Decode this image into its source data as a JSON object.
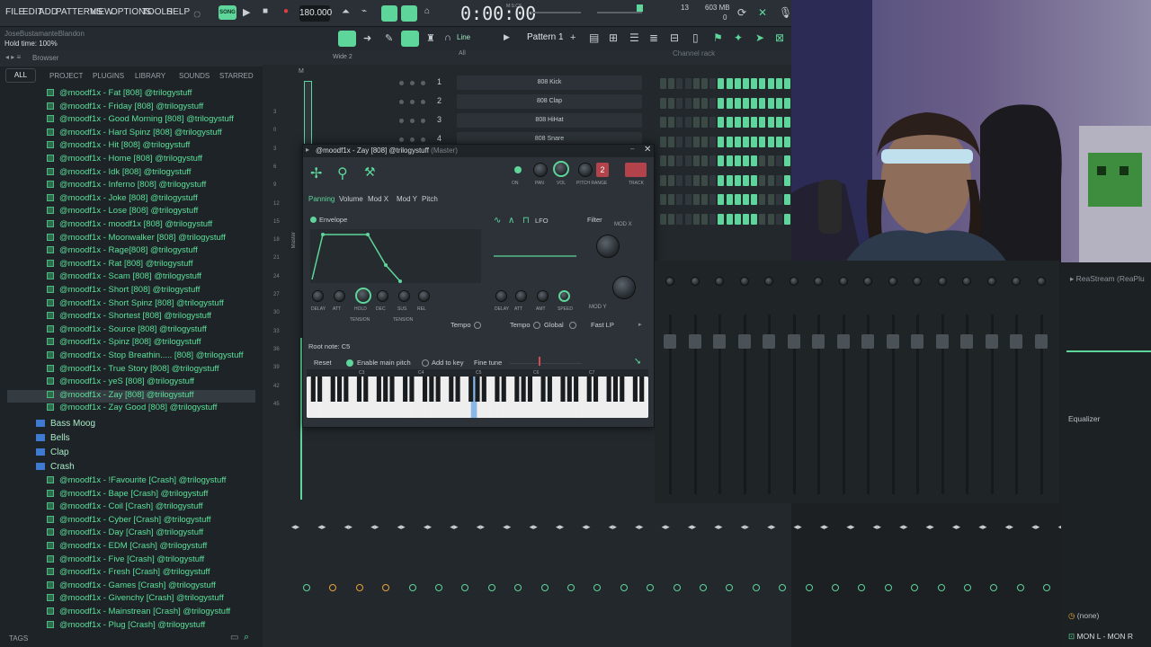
{
  "menu": {
    "file": "FILE",
    "edit": "EDIT",
    "add": "ADD",
    "patterns": "PATTERNS",
    "view": "VIEW",
    "options": "OPTIONS",
    "tools": "TOOLS",
    "help": "HELP"
  },
  "transport": {
    "song_label": "SONG",
    "tempo": "180.000",
    "time": "0:00:00",
    "time_label": "M:S:CS",
    "cpu_num": "13",
    "mem": "603 MB",
    "mem_sub": "0"
  },
  "hint": {
    "user": "JoseBustamanteBlandon",
    "hold_time": "Hold time: 100%"
  },
  "toolbar2": {
    "line": "Line",
    "pattern": "Pattern 1"
  },
  "browser": {
    "title": "Browser",
    "tabs": [
      "ALL",
      "PROJECT",
      "PLUGINS",
      "LIBRARY",
      "SOUNDS",
      "STARRED"
    ],
    "files_808": [
      "@moodf1x - Fat [808] @trilogystuff",
      "@moodf1x - Friday [808] @trilogystuff",
      "@moodf1x - Good Morning [808] @trilogystuff",
      "@moodf1x - Hard Spinz [808] @trilogystuff",
      "@moodf1x - Hit [808] @trilogystuff",
      "@moodf1x - Home [808] @trilogystuff",
      "@moodf1x - Idk [808] @trilogystuff",
      "@moodf1x - Inferno [808] @trilogystuff",
      "@moodf1x - Joke [808] @trilogystuff",
      "@moodf1x - Lose [808] @trilogystuff",
      "@moodf1x - moodf1x [808] @trilogystuff",
      "@moodf1x - Moonwalker [808] @trilogystuff",
      "@moodf1x - Rage[808] @trilogystuff",
      "@moodf1x - Rat [808] @trilogystuff",
      "@moodf1x - Scam [808] @trilogystuff",
      "@moodf1x - Short [808] @trilogystuff",
      "@moodf1x - Short Spinz [808] @trilogystuff",
      "@moodf1x - Shortest [808] @trilogystuff",
      "@moodf1x - Source [808] @trilogystuff",
      "@moodf1x - Spinz [808] @trilogystuff",
      "@moodf1x - Stop Breathin..... [808] @trilogystuff",
      "@moodf1x - True Story [808] @trilogystuff",
      "@moodf1x - yeS [808] @trilogystuff",
      "@moodf1x - Zay [808] @trilogystuff",
      "@moodf1x - Zay Good [808] @trilogystuff"
    ],
    "selected_index": 23,
    "folders": [
      "Bass Moog",
      "Bells",
      "Clap",
      "Crash"
    ],
    "files_crash": [
      "@moodf1x - !Favourite [Crash] @trilogystuff",
      "@moodf1x - Bape [Crash] @trilogystuff",
      "@moodf1x - Coil [Crash] @trilogystuff",
      "@moodf1x - Cyber [Crash] @trilogystuff",
      "@moodf1x - Day [Crash] @trilogystuff",
      "@moodf1x - EDM [Crash] @trilogystuff",
      "@moodf1x - Five [Crash] @trilogystuff",
      "@moodf1x - Fresh [Crash] @trilogystuff",
      "@moodf1x - Games [Crash] @trilogystuff",
      "@moodf1x - Givenchy [Crash] @trilogystuff",
      "@moodf1x - Mainstrean [Crash] @trilogystuff",
      "@moodf1x - Plug [Crash] @trilogystuff"
    ],
    "tags": "TAGS"
  },
  "playlist": {
    "title": "Wide 2",
    "marker": "M",
    "row_numbers": [
      "3",
      "0",
      "3",
      "6",
      "9",
      "12",
      "15",
      "18",
      "21",
      "24",
      "27",
      "30",
      "33",
      "36",
      "39",
      "42",
      "45"
    ]
  },
  "channel_rack": {
    "title": "Channel rack",
    "filter": "All",
    "channels": [
      {
        "num": "1",
        "name": "808 Kick"
      },
      {
        "num": "2",
        "name": "808 Clap"
      },
      {
        "num": "3",
        "name": "808 HiHat"
      },
      {
        "num": "4",
        "name": "808 Snare"
      }
    ]
  },
  "plugin": {
    "title": "@moodf1x - Zay [808] @trilogystuff",
    "title_suffix": "(Master)",
    "tabs": [
      "Panning",
      "Volume",
      "Mod X",
      "Mod Y",
      "Pitch"
    ],
    "top_knobs": [
      "ON",
      "PAN",
      "VOL",
      "PITCH RANGE",
      "TRACK"
    ],
    "pitch_range": "2",
    "envelope": "Envelope",
    "lfo": "LFO",
    "filter": "Filter",
    "mod_x": "MOD X",
    "mod_y": "MOD Y",
    "env_knobs": [
      "DELAY",
      "ATT",
      "HOLD",
      "DEC",
      "SUS",
      "REL"
    ],
    "lfo_knobs": [
      "DELAY",
      "ATT",
      "AMT",
      "SPEED"
    ],
    "tension": "TENSION",
    "tempo": "Tempo",
    "lfo_tempo": "Tempo",
    "global": "Global",
    "fast_lp": "Fast LP",
    "root_note": "Root note: C5",
    "reset": "Reset",
    "enable_main_pitch": "Enable main pitch",
    "add_to_key": "Add to key",
    "fine_tune": "Fine tune",
    "octaves": [
      "C3",
      "C4",
      "C5",
      "C6",
      "C7"
    ],
    "master_vert": "Master"
  },
  "mixer": {
    "plugin": "ReaStream (ReaPlu",
    "equalizer": "Equalizer",
    "none": "(none)",
    "output": "MON L - MON R"
  },
  "colors": {
    "accent": "#5ed59a",
    "orange": "#e8a33a",
    "bg": "#1c2023"
  }
}
